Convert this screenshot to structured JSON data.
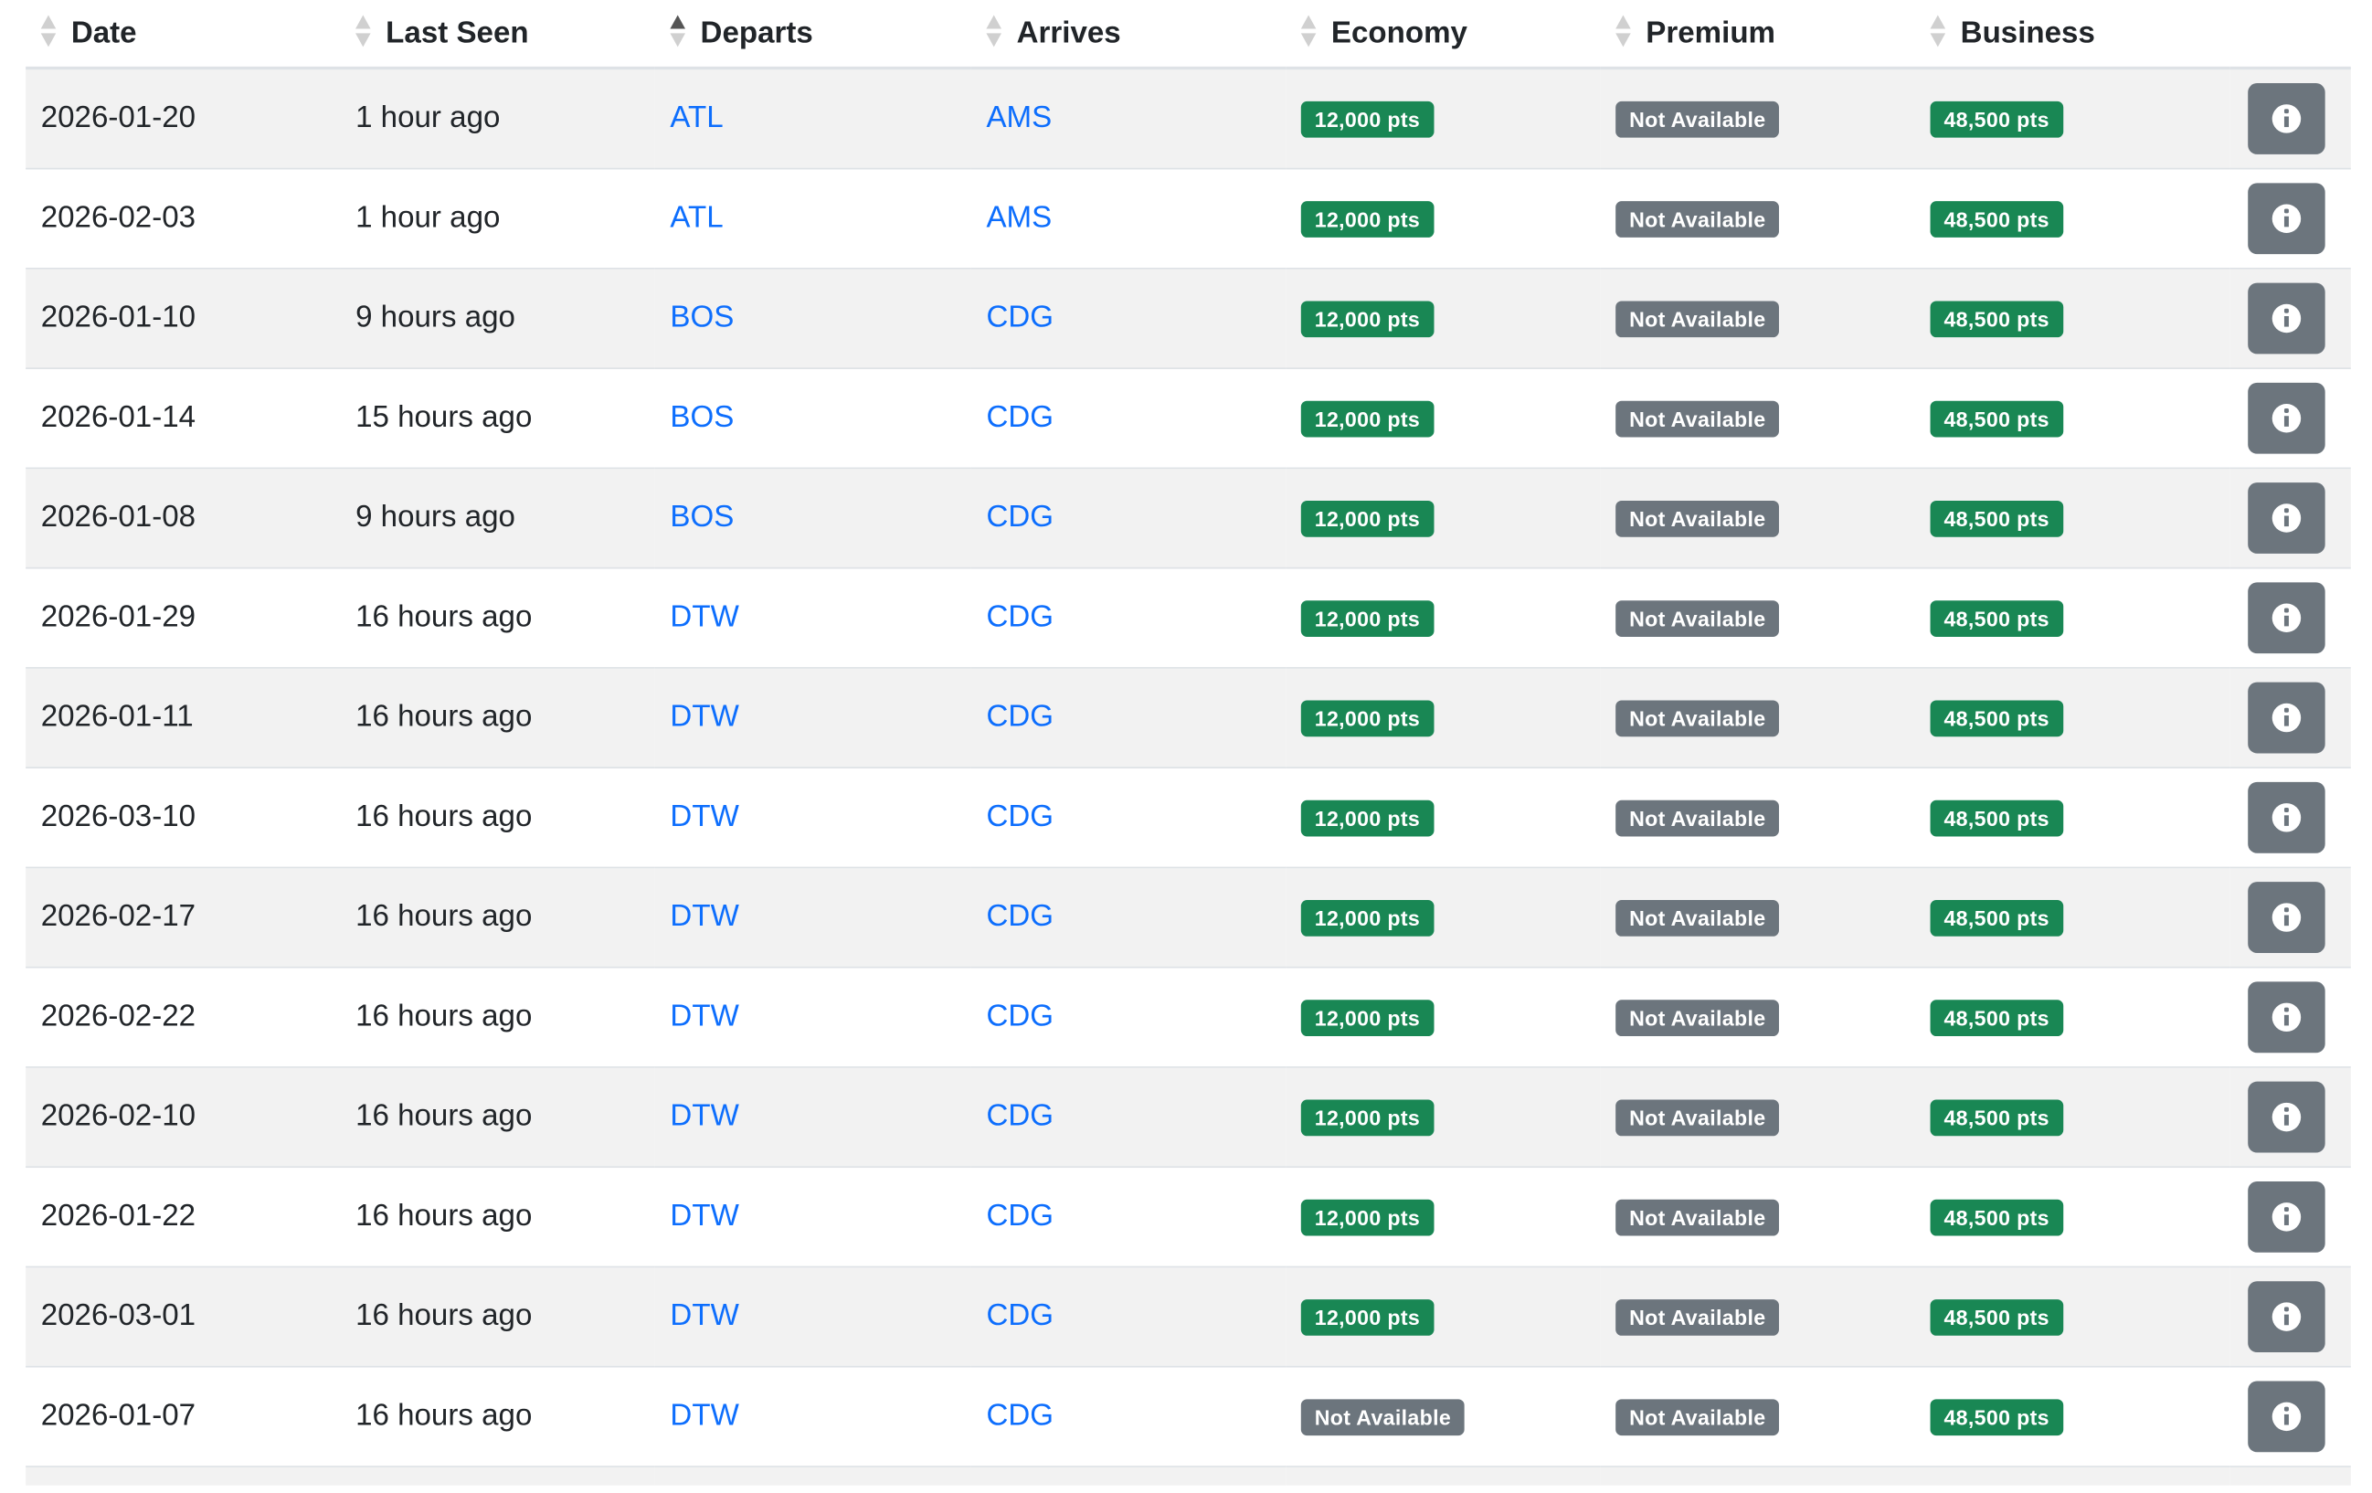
{
  "table": {
    "columns": [
      {
        "label": "Date",
        "sort": "none"
      },
      {
        "label": "Last Seen",
        "sort": "none"
      },
      {
        "label": "Departs",
        "sort": "asc"
      },
      {
        "label": "Arrives",
        "sort": "none"
      },
      {
        "label": "Economy",
        "sort": "none"
      },
      {
        "label": "Premium",
        "sort": "none"
      },
      {
        "label": "Business",
        "sort": "none"
      }
    ],
    "rows": [
      {
        "date": "2026-01-20",
        "last_seen": "1 hour ago",
        "departs": "ATL",
        "arrives": "AMS",
        "economy": "12,000 pts",
        "premium": "Not Available",
        "business": "48,500 pts"
      },
      {
        "date": "2026-02-03",
        "last_seen": "1 hour ago",
        "departs": "ATL",
        "arrives": "AMS",
        "economy": "12,000 pts",
        "premium": "Not Available",
        "business": "48,500 pts"
      },
      {
        "date": "2026-01-10",
        "last_seen": "9 hours ago",
        "departs": "BOS",
        "arrives": "CDG",
        "economy": "12,000 pts",
        "premium": "Not Available",
        "business": "48,500 pts"
      },
      {
        "date": "2026-01-14",
        "last_seen": "15 hours ago",
        "departs": "BOS",
        "arrives": "CDG",
        "economy": "12,000 pts",
        "premium": "Not Available",
        "business": "48,500 pts"
      },
      {
        "date": "2026-01-08",
        "last_seen": "9 hours ago",
        "departs": "BOS",
        "arrives": "CDG",
        "economy": "12,000 pts",
        "premium": "Not Available",
        "business": "48,500 pts"
      },
      {
        "date": "2026-01-29",
        "last_seen": "16 hours ago",
        "departs": "DTW",
        "arrives": "CDG",
        "economy": "12,000 pts",
        "premium": "Not Available",
        "business": "48,500 pts"
      },
      {
        "date": "2026-01-11",
        "last_seen": "16 hours ago",
        "departs": "DTW",
        "arrives": "CDG",
        "economy": "12,000 pts",
        "premium": "Not Available",
        "business": "48,500 pts"
      },
      {
        "date": "2026-03-10",
        "last_seen": "16 hours ago",
        "departs": "DTW",
        "arrives": "CDG",
        "economy": "12,000 pts",
        "premium": "Not Available",
        "business": "48,500 pts"
      },
      {
        "date": "2026-02-17",
        "last_seen": "16 hours ago",
        "departs": "DTW",
        "arrives": "CDG",
        "economy": "12,000 pts",
        "premium": "Not Available",
        "business": "48,500 pts"
      },
      {
        "date": "2026-02-22",
        "last_seen": "16 hours ago",
        "departs": "DTW",
        "arrives": "CDG",
        "economy": "12,000 pts",
        "premium": "Not Available",
        "business": "48,500 pts"
      },
      {
        "date": "2026-02-10",
        "last_seen": "16 hours ago",
        "departs": "DTW",
        "arrives": "CDG",
        "economy": "12,000 pts",
        "premium": "Not Available",
        "business": "48,500 pts"
      },
      {
        "date": "2026-01-22",
        "last_seen": "16 hours ago",
        "departs": "DTW",
        "arrives": "CDG",
        "economy": "12,000 pts",
        "premium": "Not Available",
        "business": "48,500 pts"
      },
      {
        "date": "2026-03-01",
        "last_seen": "16 hours ago",
        "departs": "DTW",
        "arrives": "CDG",
        "economy": "12,000 pts",
        "premium": "Not Available",
        "business": "48,500 pts"
      },
      {
        "date": "2026-01-07",
        "last_seen": "16 hours ago",
        "departs": "DTW",
        "arrives": "CDG",
        "economy": "Not Available",
        "premium": "Not Available",
        "business": "48,500 pts"
      }
    ],
    "badge_colors": {
      "available": "#198754",
      "not_available": "#6c757d"
    },
    "link_color": "#0d6efd",
    "row_action_icon": "info-circle-icon"
  }
}
